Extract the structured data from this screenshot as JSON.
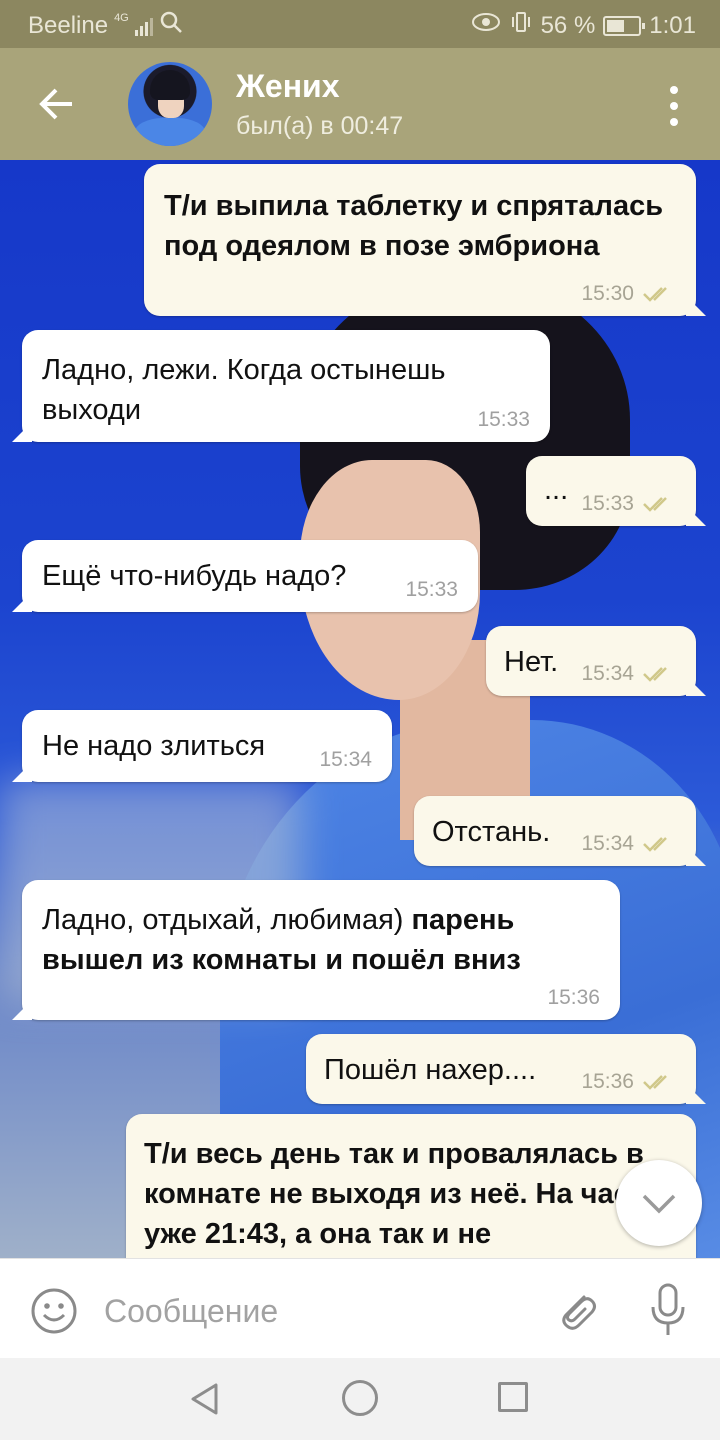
{
  "status_bar": {
    "carrier": "Beeline",
    "network": "4G",
    "battery": "56 %",
    "battery_level": 0.56,
    "time": "1:01"
  },
  "header": {
    "title": "Жених",
    "subtitle": "был(а) в 00:47",
    "accent": "#a9a47a"
  },
  "messages": [
    {
      "dir": "out",
      "text": "Т/и выпила таблетку и спряталась под одеялом в позе эмбриона",
      "time": "15:30",
      "bold": true
    },
    {
      "dir": "in",
      "text": "Ладно, лежи. Когда остынешь выходи",
      "time": "15:33"
    },
    {
      "dir": "out",
      "text": "...",
      "time": "15:33"
    },
    {
      "dir": "in",
      "text": "Ещё что-нибудь надо?",
      "time": "15:33"
    },
    {
      "dir": "out",
      "text": "Нет.",
      "time": "15:34"
    },
    {
      "dir": "in",
      "text": "Не надо злиться",
      "time": "15:34"
    },
    {
      "dir": "out",
      "text": "Отстань.",
      "time": "15:34"
    },
    {
      "dir": "in",
      "text_plain": "Ладно, отдыхай, любимая)",
      "text_bold": "парень вышел из комнаты и пошёл вниз",
      "time": "15:36"
    },
    {
      "dir": "out",
      "text": "Пошёл нахер....",
      "time": "15:36"
    },
    {
      "dir": "out",
      "text": "Т/и весь день так и провалялась в комнате не выходя из неё. На часах уже 21:43, а она так и не",
      "bold": true
    }
  ],
  "composer": {
    "placeholder": "Сообщение"
  },
  "icons": {
    "back": "arrow-left-icon",
    "menu": "more-vert-icon",
    "emoji": "smiley-icon",
    "attach": "paperclip-icon",
    "mic": "microphone-icon",
    "scroll": "chevron-down-icon",
    "read": "double-check-icon"
  }
}
